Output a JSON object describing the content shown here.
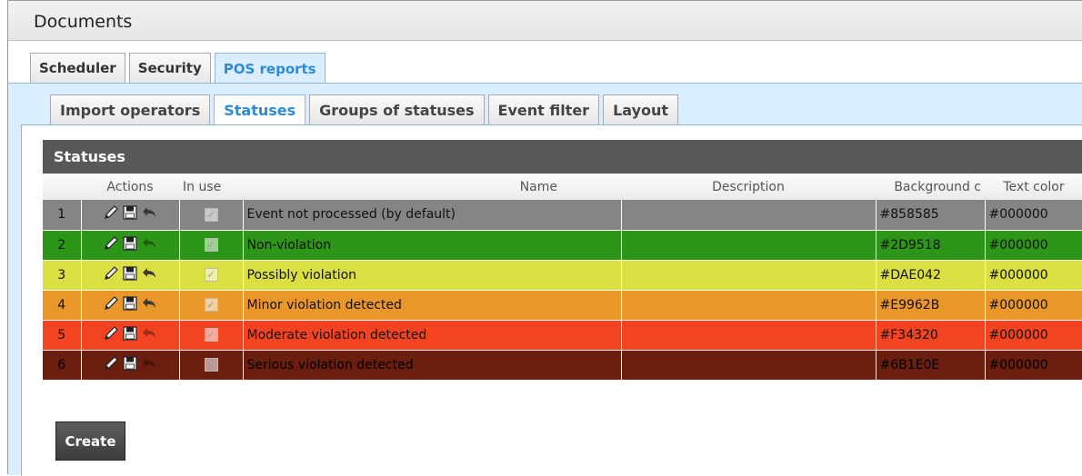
{
  "window": {
    "title": "Documents"
  },
  "main_tabs": [
    {
      "label": "Scheduler",
      "active": false
    },
    {
      "label": "Security",
      "active": false
    },
    {
      "label": "POS reports",
      "active": true
    }
  ],
  "sub_tabs": [
    {
      "label": "Import operators",
      "active": false
    },
    {
      "label": "Statuses",
      "active": true
    },
    {
      "label": "Groups of statuses",
      "active": false
    },
    {
      "label": "Event filter",
      "active": false
    },
    {
      "label": "Layout",
      "active": false
    }
  ],
  "panel": {
    "title": "Statuses",
    "columns": {
      "num": "",
      "actions": "Actions",
      "in_use": "In use",
      "name": "Name",
      "description": "Description",
      "background": "Background c",
      "text_color": "Text color"
    },
    "icons": [
      "pencil-icon",
      "save-icon",
      "undo-icon",
      "checkbox-icon"
    ],
    "rows": [
      {
        "num": "1",
        "name": "Event not processed (by default)",
        "description": "",
        "background": "#858585",
        "text_color": "#000000",
        "in_use": true
      },
      {
        "num": "2",
        "name": "Non-violation",
        "description": "",
        "background": "#2D9518",
        "text_color": "#000000",
        "in_use": true
      },
      {
        "num": "3",
        "name": "Possibly violation",
        "description": "",
        "background": "#DAE042",
        "text_color": "#000000",
        "in_use": true
      },
      {
        "num": "4",
        "name": "Minor violation detected",
        "description": "",
        "background": "#E9962B",
        "text_color": "#000000",
        "in_use": true
      },
      {
        "num": "5",
        "name": "Moderate violation detected",
        "description": "",
        "background": "#F34320",
        "text_color": "#000000",
        "in_use": true
      },
      {
        "num": "6",
        "name": "Serious violation detected",
        "description": "",
        "background": "#6B1E0E",
        "text_color": "#000000",
        "in_use": true
      }
    ]
  },
  "create_button": {
    "label": "Create"
  },
  "colors": {
    "accent": "#2e8bd6",
    "panel_header": "#585858",
    "tab_area": "#dbeeff"
  }
}
